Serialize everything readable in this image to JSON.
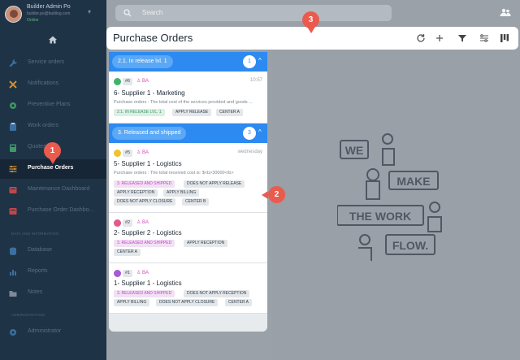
{
  "user": {
    "name": "Builder Admin Po",
    "email": "builder.po@builtlog.com",
    "status": "Online"
  },
  "sidebar": {
    "items": [
      {
        "label": "Service orders",
        "icon": "wrench-icon"
      },
      {
        "label": "Notifications",
        "icon": "tools-icon"
      },
      {
        "label": "Preventive Plans",
        "icon": "gear-icon"
      },
      {
        "label": "Work orders",
        "icon": "clipboard-icon"
      },
      {
        "label": "Quotes",
        "icon": "calculator-icon"
      },
      {
        "label": "Purchase Orders",
        "icon": "sliders-icon",
        "active": true
      },
      {
        "label": "Maintenance Dashboard",
        "icon": "dashboard-icon"
      },
      {
        "label": "Purchase Order Dashbo...",
        "icon": "dashboard-icon"
      }
    ],
    "section_data": "DATA AND INFORMATION",
    "data_items": [
      {
        "label": "Database",
        "icon": "database-icon"
      },
      {
        "label": "Reports",
        "icon": "chart-icon"
      },
      {
        "label": "Notes",
        "icon": "folder-icon"
      }
    ],
    "section_admin": "ADMINISTRATION",
    "admin_items": [
      {
        "label": "Administrator",
        "icon": "admin-icon"
      }
    ]
  },
  "search": {
    "placeholder": "Search"
  },
  "header": {
    "title": "Purchase Orders"
  },
  "groups": [
    {
      "label": "2.1. In release lvl. 1",
      "count": "1",
      "cards": [
        {
          "number": "#6",
          "person": "BA",
          "time": "10:57",
          "title": "6- Supplier 1 - Marketing",
          "subtitle": "Purchase orders : The total cost of the services provided and goods ...",
          "tags": [
            "2.1. IN RELEASE LVL. 1",
            "APPLY RELEASE",
            "CENTER A"
          ]
        }
      ]
    },
    {
      "label": "3. Released and shipped",
      "count": "3",
      "cards": [
        {
          "number": "#5",
          "person": "BA",
          "time": "wednesday",
          "title": "5- Supplier 1 - Logistics",
          "subtitle": "Purchase orders : The total received cost is: $<b>30000</b>",
          "tags": [
            "3. RELEASED AND SHIPPED",
            "DOES NOT APPLY RELEASE",
            "APPLY RECEPTION",
            "APPLY BILLING",
            "DOES NOT APPLY CLOSURE",
            "CENTER B"
          ]
        },
        {
          "number": "#2",
          "person": "BA",
          "time": "",
          "title": "2- Supplier 2 - Logistics",
          "subtitle": "",
          "tags": [
            "3. RELEASED AND SHIPPED",
            "APPLY RECEPTION",
            "CENTER A"
          ]
        },
        {
          "number": "#1",
          "person": "BA",
          "time": "",
          "title": "1- Supplier 1 - Logistics",
          "subtitle": "",
          "tags": [
            "3. RELEASED AND SHIPPED",
            "DOES NOT APPLY RECEPTION",
            "APPLY BILLING",
            "DOES NOT APPLY CLOSURE",
            "CENTER A"
          ]
        }
      ]
    }
  ],
  "logo": {
    "lines": [
      "WE",
      "MAKE",
      "THE WORK",
      "FLOW."
    ]
  },
  "callouts": [
    "1",
    "2",
    "3"
  ],
  "colors": {
    "accent": "#2c8af0",
    "callout": "#ea5b4e",
    "sidebar": "#1f3347"
  }
}
